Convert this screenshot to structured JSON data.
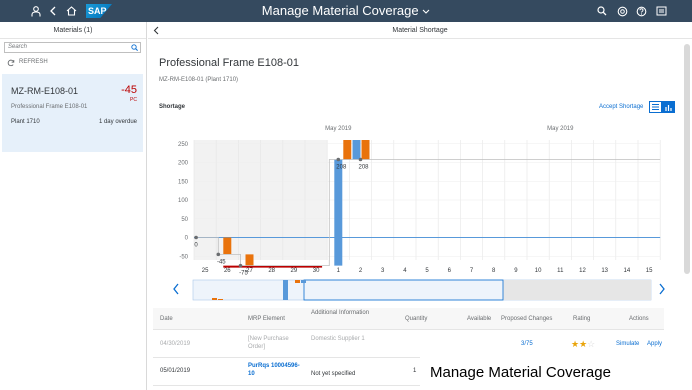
{
  "shell": {
    "title": "Manage Material Coverage",
    "logo": "SAP",
    "left_icons": [
      "user-icon",
      "back-icon",
      "home-icon"
    ],
    "right_icons": [
      "search-icon",
      "notification-icon",
      "help-icon",
      "settings-icon"
    ]
  },
  "master": {
    "header": "Materials (1)",
    "search_placeholder": "Search",
    "refresh_label": "REFRESH",
    "item": {
      "id": "MZ-RM-E108-01",
      "value": "-45",
      "unit": "PC",
      "description": "Professional Frame E108-01",
      "plant": "Plant 1710",
      "status": "1 day overdue"
    }
  },
  "detail": {
    "header": "Material Shortage",
    "title": "Professional Frame E108-01",
    "subtitle": "MZ-RM-E108-01 (Plant 1710)",
    "section": "Shortage",
    "accept_label": "Accept Shortage",
    "colors": {
      "accent": "#0a6ed1",
      "shortage": "#e9730c",
      "supply": "#5899da",
      "negative": "#bb0000"
    }
  },
  "chart_data": {
    "type": "bar",
    "month_labels": [
      "May 2019",
      "May 2019"
    ],
    "categories": [
      "25",
      "26",
      "27",
      "28",
      "29",
      "30",
      "1",
      "2",
      "3",
      "4",
      "5",
      "6",
      "7",
      "8",
      "9",
      "10",
      "11",
      "12",
      "13",
      "14",
      "15"
    ],
    "y_ticks": [
      "250",
      "200",
      "150",
      "100",
      "50",
      "0",
      "-50"
    ],
    "ylim": [
      -60,
      260
    ],
    "stock_labels": [
      "0",
      "-45",
      "-75",
      "208",
      "208"
    ],
    "stock_line": [
      0,
      -45,
      -75,
      -75,
      -75,
      -75,
      208,
      208,
      208,
      208,
      208,
      208,
      208,
      208,
      208,
      208,
      208,
      208,
      208,
      208,
      208
    ],
    "series": [
      {
        "values": [
          0,
          -45,
          -30,
          0,
          0,
          0,
          0,
          0,
          0,
          0,
          0,
          0,
          0,
          0,
          0,
          0,
          0,
          0,
          0,
          0,
          0
        ]
      },
      {
        "values": [
          0,
          0,
          0,
          0,
          0,
          0,
          283,
          0,
          0,
          0,
          0,
          0,
          0,
          0,
          0,
          0,
          0,
          0,
          0,
          0,
          0
        ]
      }
    ],
    "extra_bars": [
      {
        "day": "1",
        "kind": "shortage",
        "from": 260,
        "to": 208
      },
      {
        "day": "2",
        "kind": "supply",
        "from": 260,
        "to": 208
      },
      {
        "day": "2",
        "kind": "shortage",
        "from": 260,
        "to": 208
      }
    ]
  },
  "table": {
    "columns": [
      "Date",
      "MRP Element",
      "Additional Information",
      "Quantity",
      "Available",
      "Proposed Changes",
      "Rating",
      "Actions"
    ],
    "rows": [
      {
        "date": "04/30/2019",
        "element": "[New Purchase Order]",
        "info": "Domestic Supplier 1",
        "quantity": "",
        "available": "",
        "proposed": "3/75",
        "rating": 2,
        "simulate": "Simulate",
        "apply": "Apply"
      },
      {
        "date": "05/01/2019",
        "element": "PurRqs 10004596-10",
        "info": "Not yet specified",
        "quantity": "1",
        "available": "",
        "proposed": "",
        "rating": 0,
        "simulate": "",
        "apply": ""
      }
    ]
  },
  "caption": "Manage Material Coverage"
}
